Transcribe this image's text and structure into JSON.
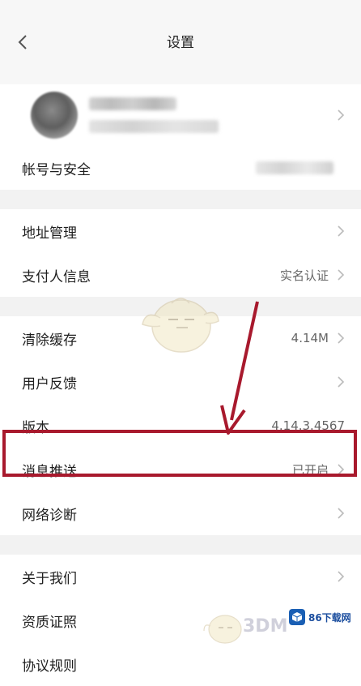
{
  "nav": {
    "title": "设置"
  },
  "account": {
    "label": "帐号与安全"
  },
  "group2": [
    {
      "label": "地址管理",
      "value": ""
    },
    {
      "label": "支付人信息",
      "value": "实名认证"
    }
  ],
  "group3": [
    {
      "label": "清除缓存",
      "value": "4.14M"
    },
    {
      "label": "用户反馈",
      "value": ""
    },
    {
      "label": "版本",
      "value": "4.14.3.4567"
    },
    {
      "label": "消息推送",
      "value": "已开启"
    },
    {
      "label": "网络诊断",
      "value": ""
    }
  ],
  "group4": [
    {
      "label": "关于我们"
    },
    {
      "label": "资质证照"
    },
    {
      "label": "协议规则"
    }
  ],
  "watermark": {
    "text": "3DM",
    "brand": "86下载网"
  },
  "colors": {
    "highlight": "#a8192d",
    "background": "#f2f2f2"
  }
}
